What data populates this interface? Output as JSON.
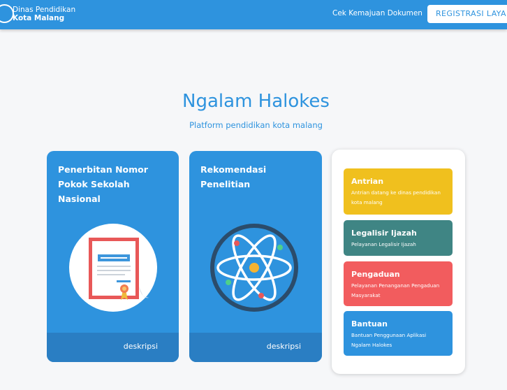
{
  "navbar": {
    "brand_line1": "Dinas Pendidikan",
    "brand_line2": "Kota Malang",
    "link_label": "Cek Kemajuan Dokumen",
    "button_label": "REGISTRASI LAYANAN"
  },
  "hero": {
    "title": "Ngalam Halokes",
    "subtitle": "Platform pendidikan kota malang"
  },
  "cards": [
    {
      "title": "Penerbitan Nomor Pokok Sekolah Nasional",
      "icon": "certificate-icon",
      "footer": "deskripsi"
    },
    {
      "title": "Rekomendasi Penelitian",
      "icon": "atom-icon",
      "footer": "deskripsi"
    }
  ],
  "services": [
    {
      "title": "Antrian",
      "desc": "Antrian datang ke dinas pendidikan kota malang",
      "color": "#f0c01e"
    },
    {
      "title": "Legalisir Ijazah",
      "desc": "Pelayanan Legalisir Ijazah",
      "color": "#3f8584"
    },
    {
      "title": "Pengaduan",
      "desc": "Pelayanan Penanganan Pengaduan Masyarakat",
      "color": "#f25c5e"
    },
    {
      "title": "Bantuan",
      "desc": "Bantuan Penggunaan Aplikasi Ngalam Halokes",
      "color": "#2e93de"
    }
  ],
  "colors": {
    "primary": "#2e93de",
    "card_footer": "#2a7ec3",
    "background": "#f6f7f9"
  }
}
